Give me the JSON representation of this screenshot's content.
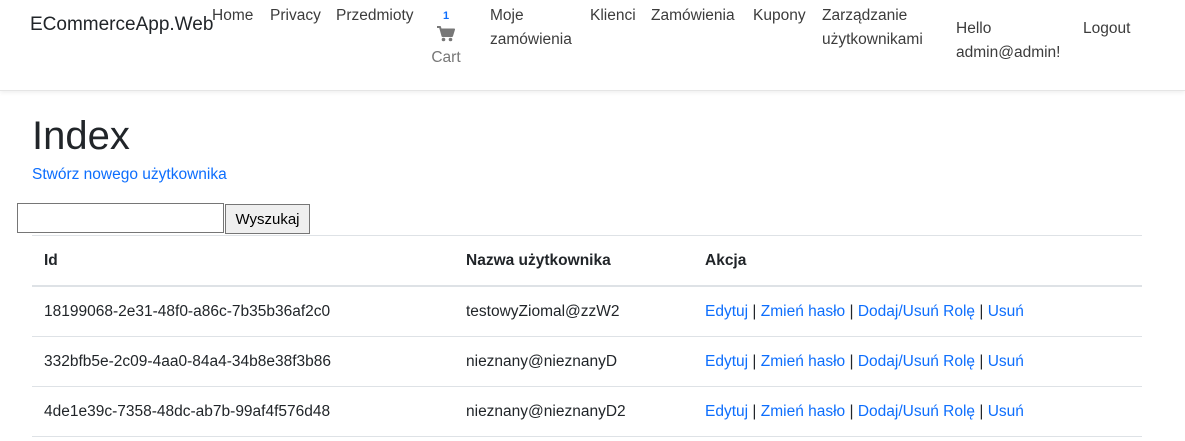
{
  "navbar": {
    "brand": "ECommerceApp.Web",
    "links": {
      "home": "Home",
      "privacy": "Privacy",
      "items": "Przedmioty",
      "my_orders": "Moje zamówienia",
      "clients": "Klienci",
      "orders": "Zamówienia",
      "coupons": "Kupony",
      "user_management": "Zarządzanie użytkownikami"
    },
    "cart": {
      "count": "1",
      "label": "Cart"
    },
    "greeting": "Hello admin@admin!",
    "logout": "Logout"
  },
  "page": {
    "title": "Index",
    "create_link": "Stwórz nowego użytkownika",
    "search": {
      "value": "",
      "placeholder": "",
      "button": "Wyszukaj"
    }
  },
  "table": {
    "headers": [
      "Id",
      "Nazwa użytkownika",
      "Akcja"
    ],
    "actions": {
      "edit": "Edytuj",
      "change_password": "Zmień hasło",
      "roles": "Dodaj/Usuń Rolę",
      "delete": "Usuń",
      "separator": "|"
    },
    "rows": [
      {
        "id": "18199068-2e31-48f0-a86c-7b35b36af2c0",
        "username": "testowyZiomal@zzW2"
      },
      {
        "id": "332bfb5e-2c09-4aa0-84a4-34b8e38f3b86",
        "username": "nieznany@nieznanyD"
      },
      {
        "id": "4de1e39c-7358-48dc-ab7b-99af4f576d48",
        "username": "nieznany@nieznanyD2"
      }
    ]
  }
}
